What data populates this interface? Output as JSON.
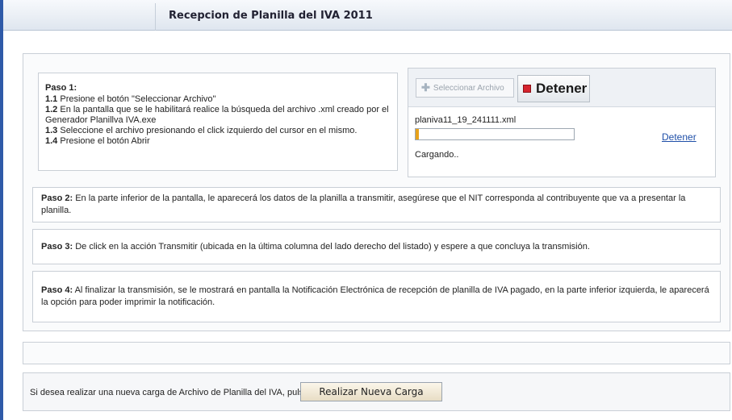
{
  "header": {
    "title": "Recepcion de Planilla del IVA 2011"
  },
  "paso1": {
    "heading": "Paso 1:",
    "items": [
      {
        "num": "1.1",
        "text": " Presione el botón \"Seleccionar Archivo\""
      },
      {
        "num": "1.2",
        "text": " En la pantalla que se le habilitará realice la búsqueda del archivo .xml creado por el Generador Planillva IVA.exe"
      },
      {
        "num": "1.3",
        "text": " Seleccione el archivo presionando el click izquierdo del cursor en el mismo."
      },
      {
        "num": "1.4",
        "text": " Presione el botón Abrir"
      }
    ]
  },
  "uploader": {
    "select_label": "Seleccionar Archivo",
    "stop_label": "Detener",
    "file_name": "planiva11_19_241111.xml",
    "progress": 0.01,
    "cancel_link": "Detener",
    "status": "Cargando.."
  },
  "steps": [
    {
      "label": "Paso 2:",
      "text": " En la parte inferior de la pantalla, le aparecerá los datos de la planilla a transmitir, asegúrese que el NIT corresponda al contribuyente que va a presentar la planilla."
    },
    {
      "label": "Paso 3:",
      "text": " De click en la acción Transmitir (ubicada en la última columna del lado derecho del listado) y espere a que concluya la transmisión."
    },
    {
      "label": "Paso 4:",
      "text": " Al finalizar la transmisión, se le mostrará en pantalla la Notificación Electrónica de recepción de planilla de IVA pagado, en la parte inferior izquierda, le aparecerá la opción para poder imprimir la notificación."
    }
  ],
  "footer": {
    "text": "Si desea realizar una nueva carga de Archivo de Planilla del IVA, pulse",
    "button_label": "Realizar Nueva Carga"
  },
  "colors": {
    "accent": "#2f5aa8",
    "stop": "#d6242e",
    "progress": "#e8a21a",
    "link": "#1f4fa8"
  }
}
